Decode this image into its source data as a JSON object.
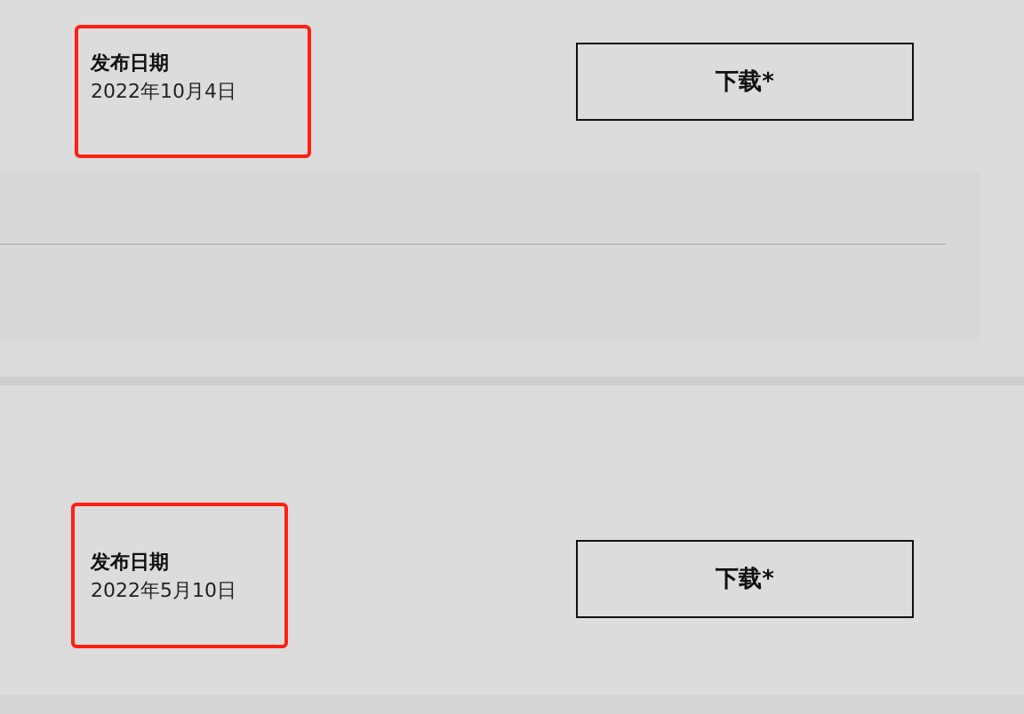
{
  "releases": [
    {
      "date_label": "发布日期",
      "date": "2022年10月4日",
      "highlighted": true,
      "button": "下载*"
    },
    {
      "date_label": "发布日期",
      "date": "2022年5月10日",
      "highlighted": true,
      "button": "下载*"
    }
  ]
}
